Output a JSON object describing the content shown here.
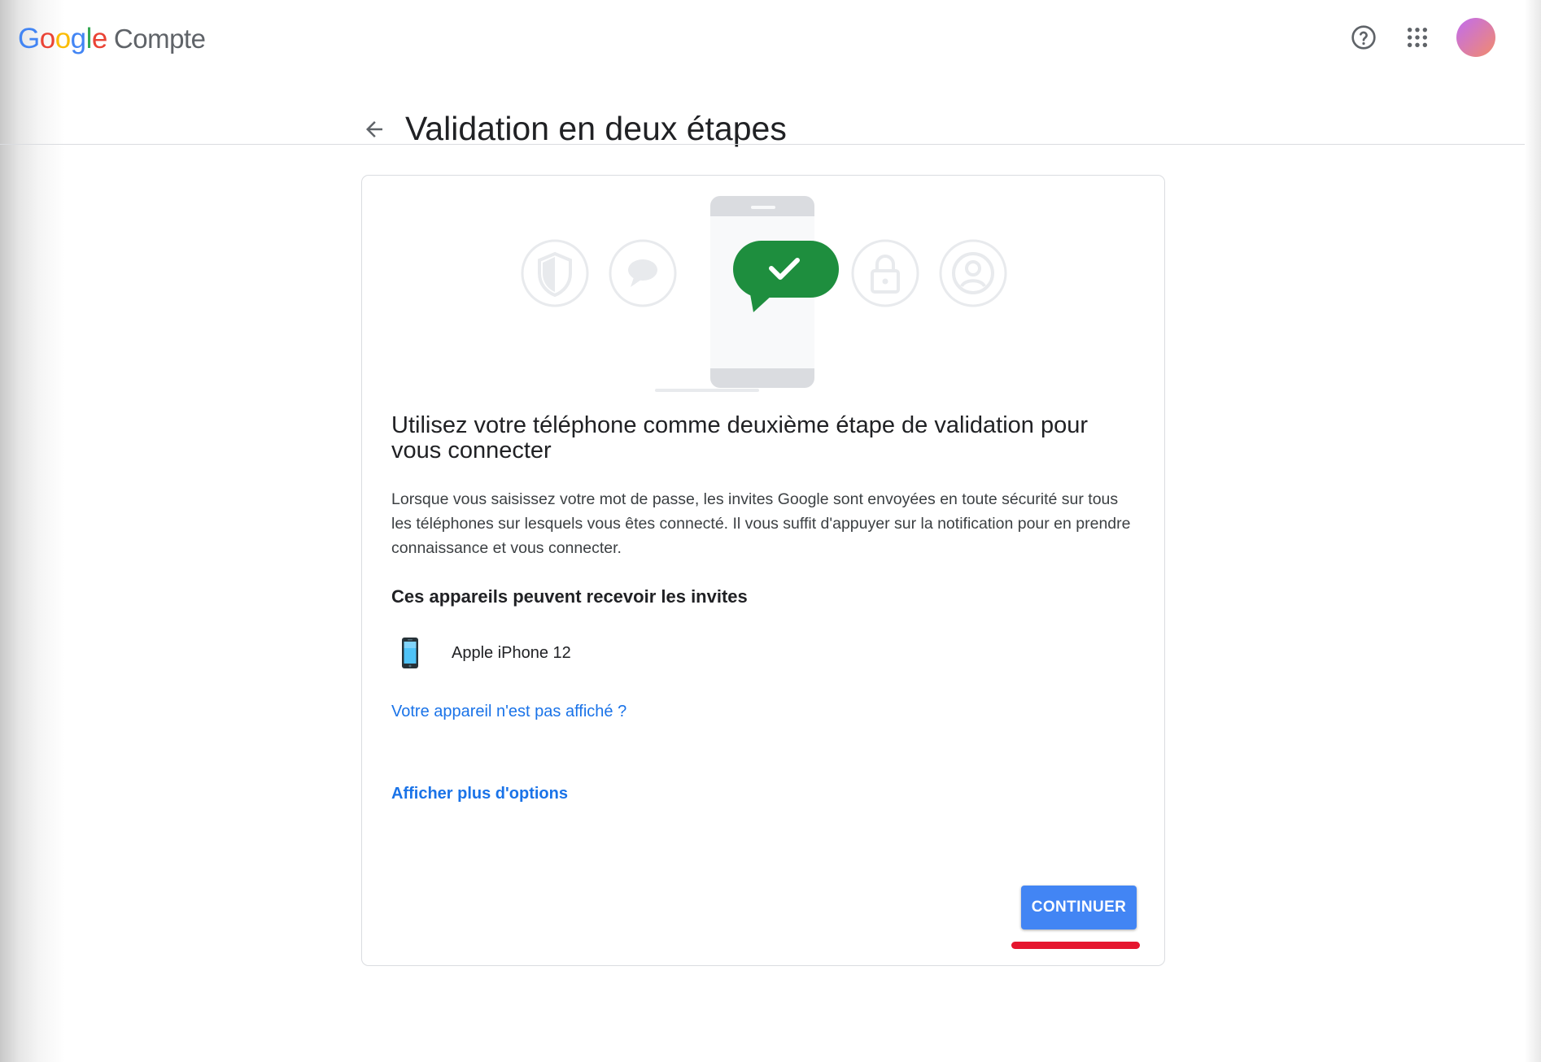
{
  "header": {
    "logo_letters": [
      "G",
      "o",
      "o",
      "g",
      "l",
      "e"
    ],
    "product": "Compte",
    "help_icon": "help-circle-icon",
    "apps_icon": "apps-grid-icon",
    "avatar_colors": [
      "#c06cf0",
      "#f28b6b"
    ]
  },
  "page": {
    "back_icon": "arrow-back-icon",
    "title": "Validation en deux étapes"
  },
  "card": {
    "illustration_icons": [
      "shield-icon",
      "chat-bubble-icon",
      "phone-check-icon",
      "lock-icon",
      "account-icon"
    ],
    "heading": "Utilisez votre téléphone comme deuxième étape de validation pour vous connecter",
    "description": "Lorsque vous saisissez votre mot de passe, les invites Google sont envoyées en toute sécurité sur tous les téléphones sur lesquels vous êtes connecté. Il vous suffit d'appuyer sur la notification pour en prendre connaissance et vous connecter.",
    "devices_heading": "Ces appareils peuvent recevoir les invites",
    "devices": [
      {
        "name": "Apple iPhone 12",
        "icon": "smartphone-icon"
      }
    ],
    "link_device_missing": "Votre appareil n'est pas affiché ?",
    "link_more_options": "Afficher plus d'options",
    "continue_label": "CONTINUER"
  },
  "colors": {
    "accent": "#1a73e8",
    "button": "#4285f4",
    "success": "#1e8e3e",
    "highlight": "#e5152e"
  }
}
